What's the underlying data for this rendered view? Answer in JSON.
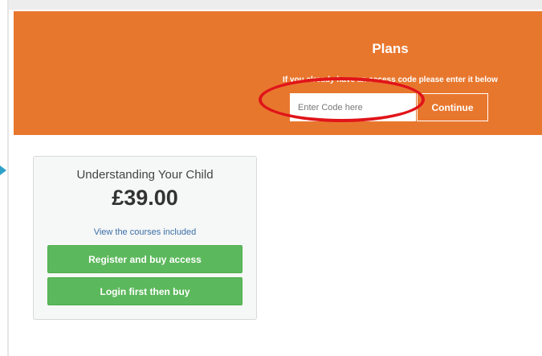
{
  "banner": {
    "title": "Plans",
    "subtitle": "If you already have an access code please enter it below",
    "code_placeholder": "Enter Code here",
    "continue_label": "Continue",
    "background_color": "#e8772e"
  },
  "annotations": {
    "highlight_ring_color": "#e0141a",
    "pointer_arrow_color": "#2ea0c8"
  },
  "plan": {
    "name": "Understanding Your Child",
    "price": "£39.00",
    "courses_link": "View the courses included",
    "register_label": "Register and buy access",
    "login_label": "Login first then buy",
    "button_color": "#5cb85c"
  }
}
